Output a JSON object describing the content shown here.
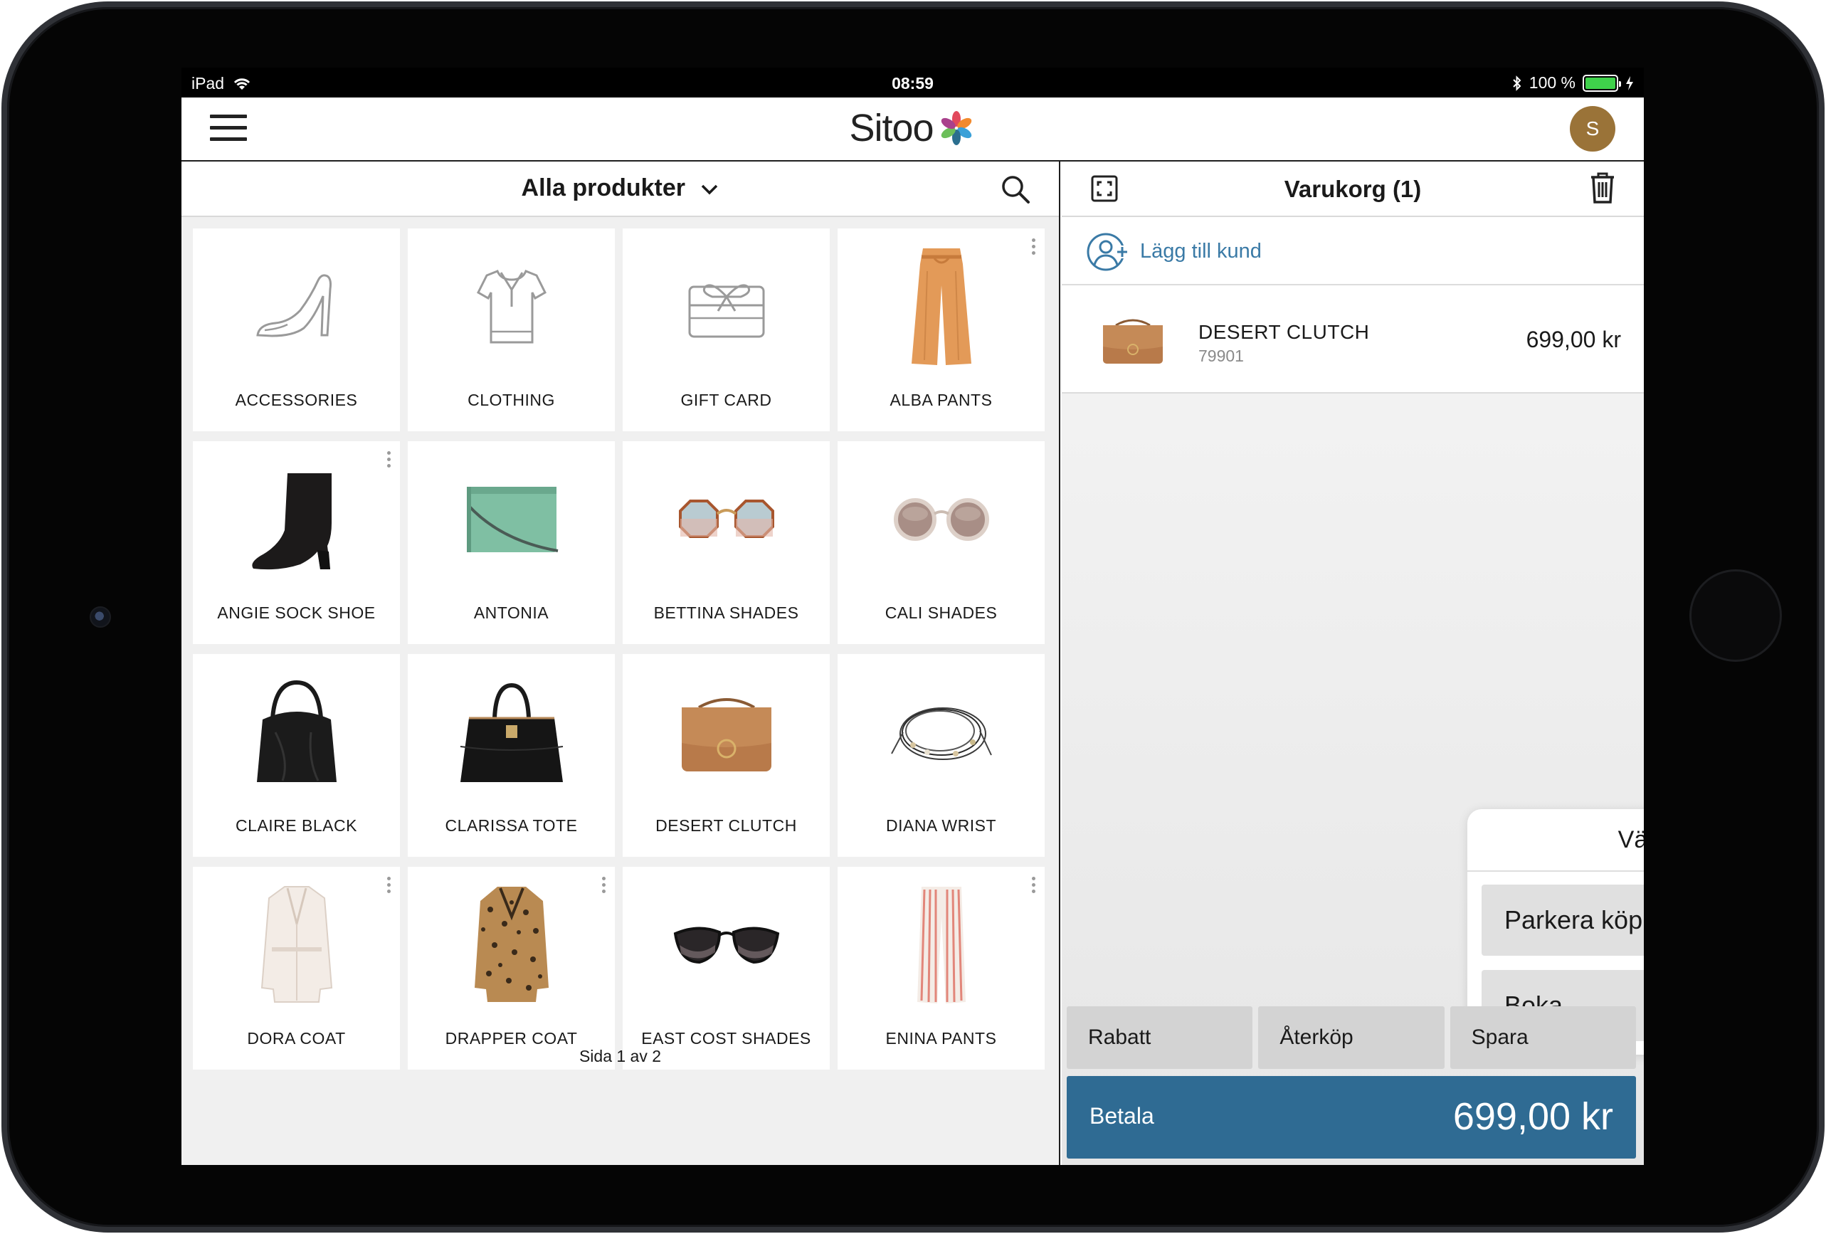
{
  "status_bar": {
    "device": "iPad",
    "time": "08:59",
    "battery": "100 %",
    "battery_level": 1.0,
    "battery_color": "#3fd14b"
  },
  "header": {
    "logo_text": "Sitoo",
    "avatar_initial": "S",
    "avatar_color": "#9a7338"
  },
  "catalog": {
    "category": "Alla produkter",
    "products": [
      {
        "label": "ACCESSORIES",
        "icon": "high-heel-shoe-icon"
      },
      {
        "label": "CLOTHING",
        "icon": "shirt-icon"
      },
      {
        "label": "GIFT CARD",
        "icon": "gift-card-icon"
      },
      {
        "label": "ALBA PANTS",
        "icon": "pants-image"
      },
      {
        "label": "ANGIE SOCK SHOE",
        "icon": "boot-image"
      },
      {
        "label": "ANTONIA",
        "icon": "clutch-green-image"
      },
      {
        "label": "BETTINA SHADES",
        "icon": "sunglasses-octagon-image"
      },
      {
        "label": "CALI SHADES",
        "icon": "sunglasses-round-image"
      },
      {
        "label": "CLAIRE BLACK",
        "icon": "hobo-bag-image"
      },
      {
        "label": "CLARISSA TOTE",
        "icon": "tote-bag-image"
      },
      {
        "label": "DESERT CLUTCH",
        "icon": "suede-bag-image"
      },
      {
        "label": "DIANA WRIST",
        "icon": "bracelet-image"
      },
      {
        "label": "DORA COAT",
        "icon": "white-coat-image"
      },
      {
        "label": "DRAPPER COAT",
        "icon": "leopard-coat-image"
      },
      {
        "label": "EAST COST SHADES",
        "icon": "cat-eye-sunglasses-image"
      },
      {
        "label": "ENINA PANTS",
        "icon": "striped-pants-image"
      }
    ],
    "pagination": "Sida 1 av 2"
  },
  "cart": {
    "title": "Varukorg (1)",
    "add_customer": "Lägg till kund",
    "items": [
      {
        "name": "DESERT CLUTCH",
        "sku": "79901",
        "price": "699,00 kr"
      }
    ]
  },
  "popover": {
    "title": "Välj",
    "options": [
      "Parkera köp",
      "Boka"
    ]
  },
  "actions": {
    "discount": "Rabatt",
    "return": "Återköp",
    "save": "Spara",
    "pay_label": "Betala",
    "pay_amount": "699,00 kr",
    "pay_color": "#2f6b93"
  }
}
